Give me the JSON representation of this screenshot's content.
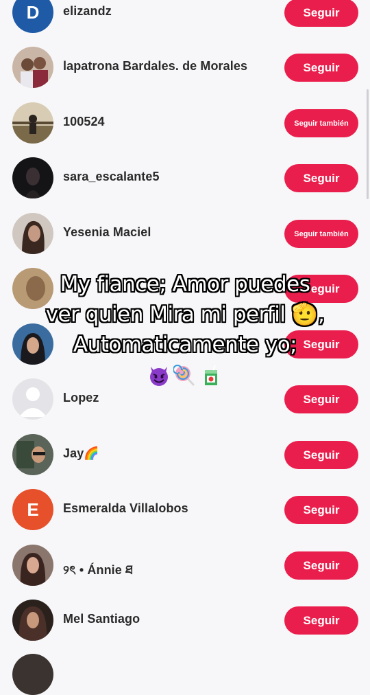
{
  "rows": [
    {
      "name": "elizandz",
      "button": "Seguir",
      "avatar": "letter-avatar",
      "letter": "D",
      "avatar_color": "#1e5aa6",
      "button_small": false
    },
    {
      "name": "lapatrona Bardales. de Morales",
      "button": "Seguir",
      "avatar": "photo-avatar",
      "avatar_color": "#b49a84",
      "button_small": false
    },
    {
      "name": "100524",
      "button": "Seguir también",
      "avatar": "photo-avatar",
      "avatar_color": "#8c7a60",
      "button_small": true
    },
    {
      "name": "sara_escalante5",
      "button": "Seguir",
      "avatar": "photo-avatar",
      "avatar_color": "#1c1c1e",
      "button_small": false
    },
    {
      "name": "Yesenia Maciel",
      "button": "Seguir también",
      "avatar": "photo-avatar",
      "avatar_color": "#5a463c",
      "button_small": true
    },
    {
      "name": "",
      "button": "Seguir",
      "avatar": "photo-avatar",
      "avatar_color": "#a4845c",
      "button_small": false
    },
    {
      "name": "",
      "button": "Seguir",
      "avatar": "photo-avatar",
      "avatar_color": "#2c5c8c",
      "button_small": false
    },
    {
      "name": "Lopez",
      "button": "Seguir",
      "avatar": "default-avatar",
      "avatar_color": "#e4e4e8",
      "button_small": false
    },
    {
      "name": "Jay🌈",
      "button": "Seguir",
      "avatar": "photo-avatar",
      "avatar_color": "#4a4e48",
      "button_small": false
    },
    {
      "name": "Esmeralda Villalobos",
      "button": "Seguir",
      "avatar": "letter-avatar",
      "letter": "E",
      "avatar_color": "#e6502a",
      "button_small": false
    },
    {
      "name": "୨ৎ • Ánnie ཐ",
      "button": "Seguir",
      "avatar": "photo-avatar",
      "avatar_color": "#6a5048",
      "button_small": false
    },
    {
      "name": "Mel Santiago",
      "button": "Seguir",
      "avatar": "photo-avatar",
      "avatar_color": "#3a2c28",
      "button_small": false
    }
  ],
  "caption": {
    "line1": "My fiance; Amor puedes",
    "line2": "ver quien Mira mi perfil 🫡,",
    "line3": "Automaticamente yo;",
    "emojis": [
      "smiling-imp",
      "lollipop",
      "beverage-box"
    ]
  },
  "colors": {
    "button": "#ea1e4c",
    "background": "#f7f7f9",
    "text": "#2a2a2a"
  }
}
